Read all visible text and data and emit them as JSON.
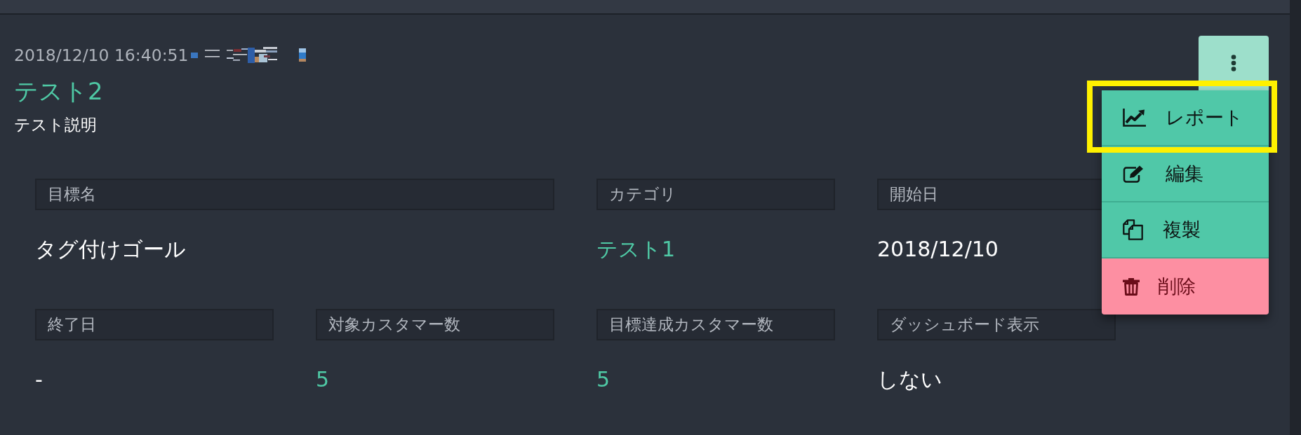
{
  "header": {
    "timestamp": "2018/12/10 16:40:51",
    "title": "テスト2",
    "description": "テスト説明"
  },
  "menu": {
    "open": true,
    "items": [
      {
        "kind": "report",
        "label": "レポート",
        "highlighted": true
      },
      {
        "kind": "edit",
        "label": "編集",
        "highlighted": false
      },
      {
        "kind": "duplicate",
        "label": "複製",
        "highlighted": false
      },
      {
        "kind": "delete",
        "label": "削除",
        "highlighted": false
      }
    ]
  },
  "fields": [
    {
      "label": "目標名",
      "value": "タグ付けゴール",
      "kind": "text"
    },
    {
      "label": "カテゴリ",
      "value": "テスト1",
      "kind": "link"
    },
    {
      "label": "開始日",
      "value": "2018/12/10",
      "kind": "text"
    },
    {
      "label": "終了日",
      "value": "-",
      "kind": "text"
    },
    {
      "label": "対象カスタマー数",
      "value": "5",
      "kind": "link"
    },
    {
      "label": "目標達成カスタマー数",
      "value": "5",
      "kind": "link"
    },
    {
      "label": "ダッシュボード表示",
      "value": "しない",
      "kind": "text"
    }
  ]
}
